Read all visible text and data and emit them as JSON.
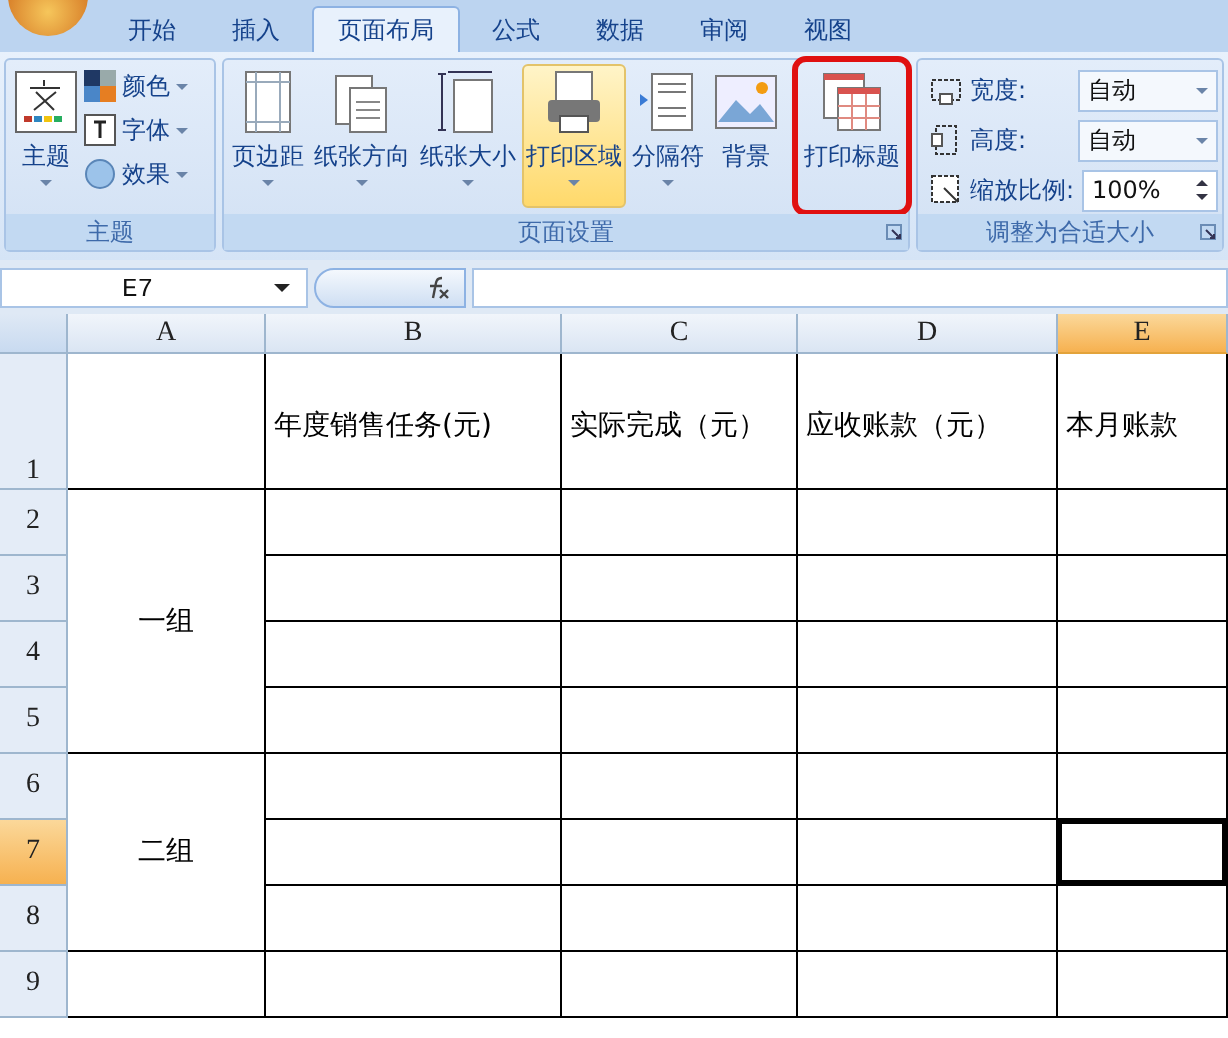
{
  "tabs": [
    {
      "label": "开始",
      "selected": false
    },
    {
      "label": "插入",
      "selected": false
    },
    {
      "label": "页面布局",
      "selected": true
    },
    {
      "label": "公式",
      "selected": false
    },
    {
      "label": "数据",
      "selected": false
    },
    {
      "label": "审阅",
      "selected": false
    },
    {
      "label": "视图",
      "selected": false
    }
  ],
  "ribbon": {
    "groups": [
      {
        "kind": "theme",
        "label": "主题",
        "launcher": false,
        "main": {
          "label": "主题",
          "dropdown": true
        },
        "items": [
          {
            "kind": "colors",
            "label": "颜色",
            "dropdown": true
          },
          {
            "kind": "fonts",
            "label": "字体",
            "dropdown": true
          },
          {
            "kind": "effects",
            "label": "效果",
            "dropdown": true
          }
        ]
      },
      {
        "kind": "buttons",
        "label": "页面设置",
        "launcher": true,
        "buttons": [
          {
            "kind": "margins",
            "label": "页边距",
            "dropdown": true,
            "active": false,
            "marked": false
          },
          {
            "kind": "orientation",
            "label": "纸张方向",
            "dropdown": true,
            "active": false,
            "marked": false
          },
          {
            "kind": "size",
            "label": "纸张大小",
            "dropdown": true,
            "active": false,
            "marked": false
          },
          {
            "kind": "print-area",
            "label": "打印区域",
            "dropdown": true,
            "active": true,
            "marked": false
          },
          {
            "kind": "breaks",
            "label": "分隔符",
            "dropdown": true,
            "active": false,
            "marked": false
          },
          {
            "kind": "background",
            "label": "背景",
            "dropdown": false,
            "active": false,
            "marked": false
          },
          {
            "kind": "print-titles",
            "label": "打印标题",
            "dropdown": false,
            "active": false,
            "marked": true
          }
        ]
      },
      {
        "kind": "scale",
        "label": "调整为合适大小",
        "launcher": true,
        "fields": [
          {
            "kind": "dropdown",
            "label": "宽度:",
            "value": "自动"
          },
          {
            "kind": "dropdown",
            "label": "高度:",
            "value": "自动"
          },
          {
            "kind": "spinner",
            "label": "缩放比例:",
            "value": "100%"
          }
        ]
      }
    ]
  },
  "formula_bar": {
    "name_box": "E7"
  },
  "sheet": {
    "columns": [
      {
        "label": "A",
        "selected": false
      },
      {
        "label": "B",
        "selected": false,
        "heading": "年度销售任务(元)"
      },
      {
        "label": "C",
        "selected": false,
        "heading": "实际完成（元）"
      },
      {
        "label": "D",
        "selected": false,
        "heading": "应收账款（元）"
      },
      {
        "label": "E",
        "selected": true,
        "heading": "本月账款"
      }
    ],
    "first_row": {
      "label": "1",
      "selected": false
    },
    "groups": [
      {
        "label": "一组",
        "rows": [
          {
            "label": "2",
            "selected": false
          },
          {
            "label": "3",
            "selected": false
          },
          {
            "label": "4",
            "selected": false
          },
          {
            "label": "5",
            "selected": false
          }
        ]
      },
      {
        "label": "二组",
        "rows": [
          {
            "label": "6",
            "selected": false
          },
          {
            "label": "7",
            "selected": true
          },
          {
            "label": "8",
            "selected": false
          }
        ]
      },
      {
        "rows": [
          {
            "label": "9",
            "selected": false
          }
        ]
      }
    ]
  }
}
